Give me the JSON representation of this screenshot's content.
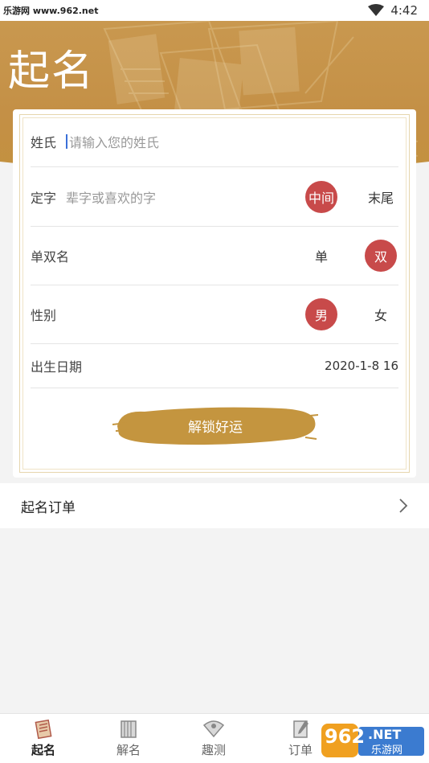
{
  "watermark_top": "乐游网 www.962.net",
  "status": {
    "time": "4:42"
  },
  "header": {
    "title": "起名"
  },
  "form": {
    "surname": {
      "label": "姓氏",
      "placeholder": "请输入您的姓氏"
    },
    "fixed_char": {
      "label": "定字",
      "placeholder": "辈字或喜欢的字",
      "options": [
        "中间",
        "末尾"
      ],
      "selected": "中间"
    },
    "name_type": {
      "label": "单双名",
      "options": [
        "单",
        "双"
      ],
      "selected": "双"
    },
    "gender": {
      "label": "性别",
      "options": [
        "男",
        "女"
      ],
      "selected": "男"
    },
    "birth": {
      "label": "出生日期",
      "value": "2020-1-8 16"
    },
    "unlock_label": "解锁好运"
  },
  "order": {
    "label": "起名订单"
  },
  "tabs": [
    {
      "label": "起名",
      "icon": "naming-icon",
      "active": true
    },
    {
      "label": "解名",
      "icon": "book-icon",
      "active": false
    },
    {
      "label": "趣测",
      "icon": "fan-icon",
      "active": false
    },
    {
      "label": "订单",
      "icon": "order-icon",
      "active": false
    }
  ],
  "watermark_bottom": {
    "num": "962",
    "net": ".NET",
    "site": "乐游网"
  },
  "colors": {
    "accent_gold": "#c49046",
    "chip_red": "#c84a4a"
  }
}
